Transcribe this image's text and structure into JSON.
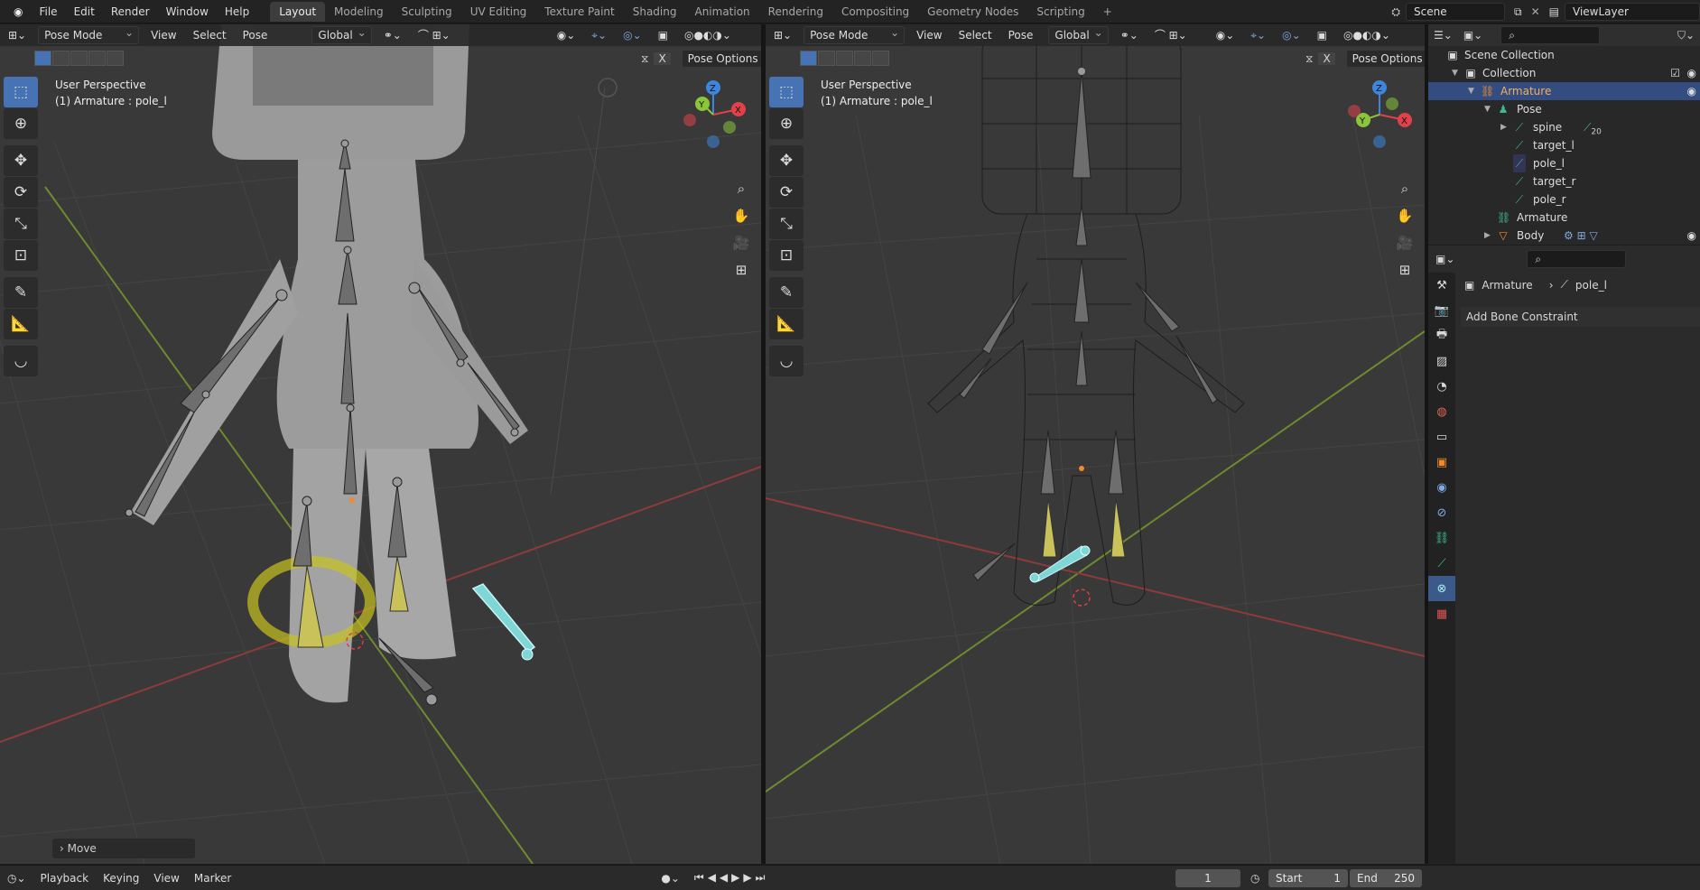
{
  "topbar": {
    "menus": [
      "File",
      "Edit",
      "Render",
      "Window",
      "Help"
    ],
    "workspaces": [
      "Layout",
      "Modeling",
      "Sculpting",
      "UV Editing",
      "Texture Paint",
      "Shading",
      "Animation",
      "Rendering",
      "Compositing",
      "Geometry Nodes",
      "Scripting"
    ],
    "active_workspace": "Layout",
    "add_tab": "+",
    "scene": "Scene",
    "view_layer": "ViewLayer"
  },
  "viewport_left": {
    "mode": "Pose Mode",
    "menus": [
      "View",
      "Select",
      "Pose"
    ],
    "orientation": "Global",
    "perspective": "User Perspective",
    "context": "(1) Armature : pole_l",
    "pose_options": "Pose Options",
    "x_toggle": "X",
    "last_op": "Move"
  },
  "viewport_right": {
    "mode": "Pose Mode",
    "menus": [
      "View",
      "Select",
      "Pose"
    ],
    "orientation": "Global",
    "perspective": "User Perspective",
    "context": "(1) Armature : pole_l",
    "pose_options": "Pose Options",
    "x_toggle": "X"
  },
  "gizmo": {
    "x": "X",
    "y": "Y",
    "z": "Z",
    "color_x": "#e0414a",
    "color_y": "#8ac53a",
    "color_z": "#3e86dd"
  },
  "outliner": {
    "scene_collection": "Scene Collection",
    "collection": "Collection",
    "armature_object": "Armature",
    "pose": "Pose",
    "bones": [
      "spine",
      "target_l",
      "pole_l",
      "target_r",
      "pole_r"
    ],
    "spine_count": "20",
    "armature_data": "Armature",
    "body": "Body"
  },
  "properties": {
    "breadcrumb_object": "Armature",
    "breadcrumb_bone": "pole_l",
    "add_constraint": "Add Bone Constraint"
  },
  "timeline": {
    "menus": [
      "Playback",
      "Keying",
      "View",
      "Marker"
    ],
    "current_frame": "1",
    "start_label": "Start",
    "start": "1",
    "end_label": "End",
    "end": "250"
  },
  "colors": {
    "accent": "#4772b3",
    "selected_bone": "#7fd6d6",
    "active_object": "#f08a2c",
    "bone_constraint": "#c9c25a"
  }
}
